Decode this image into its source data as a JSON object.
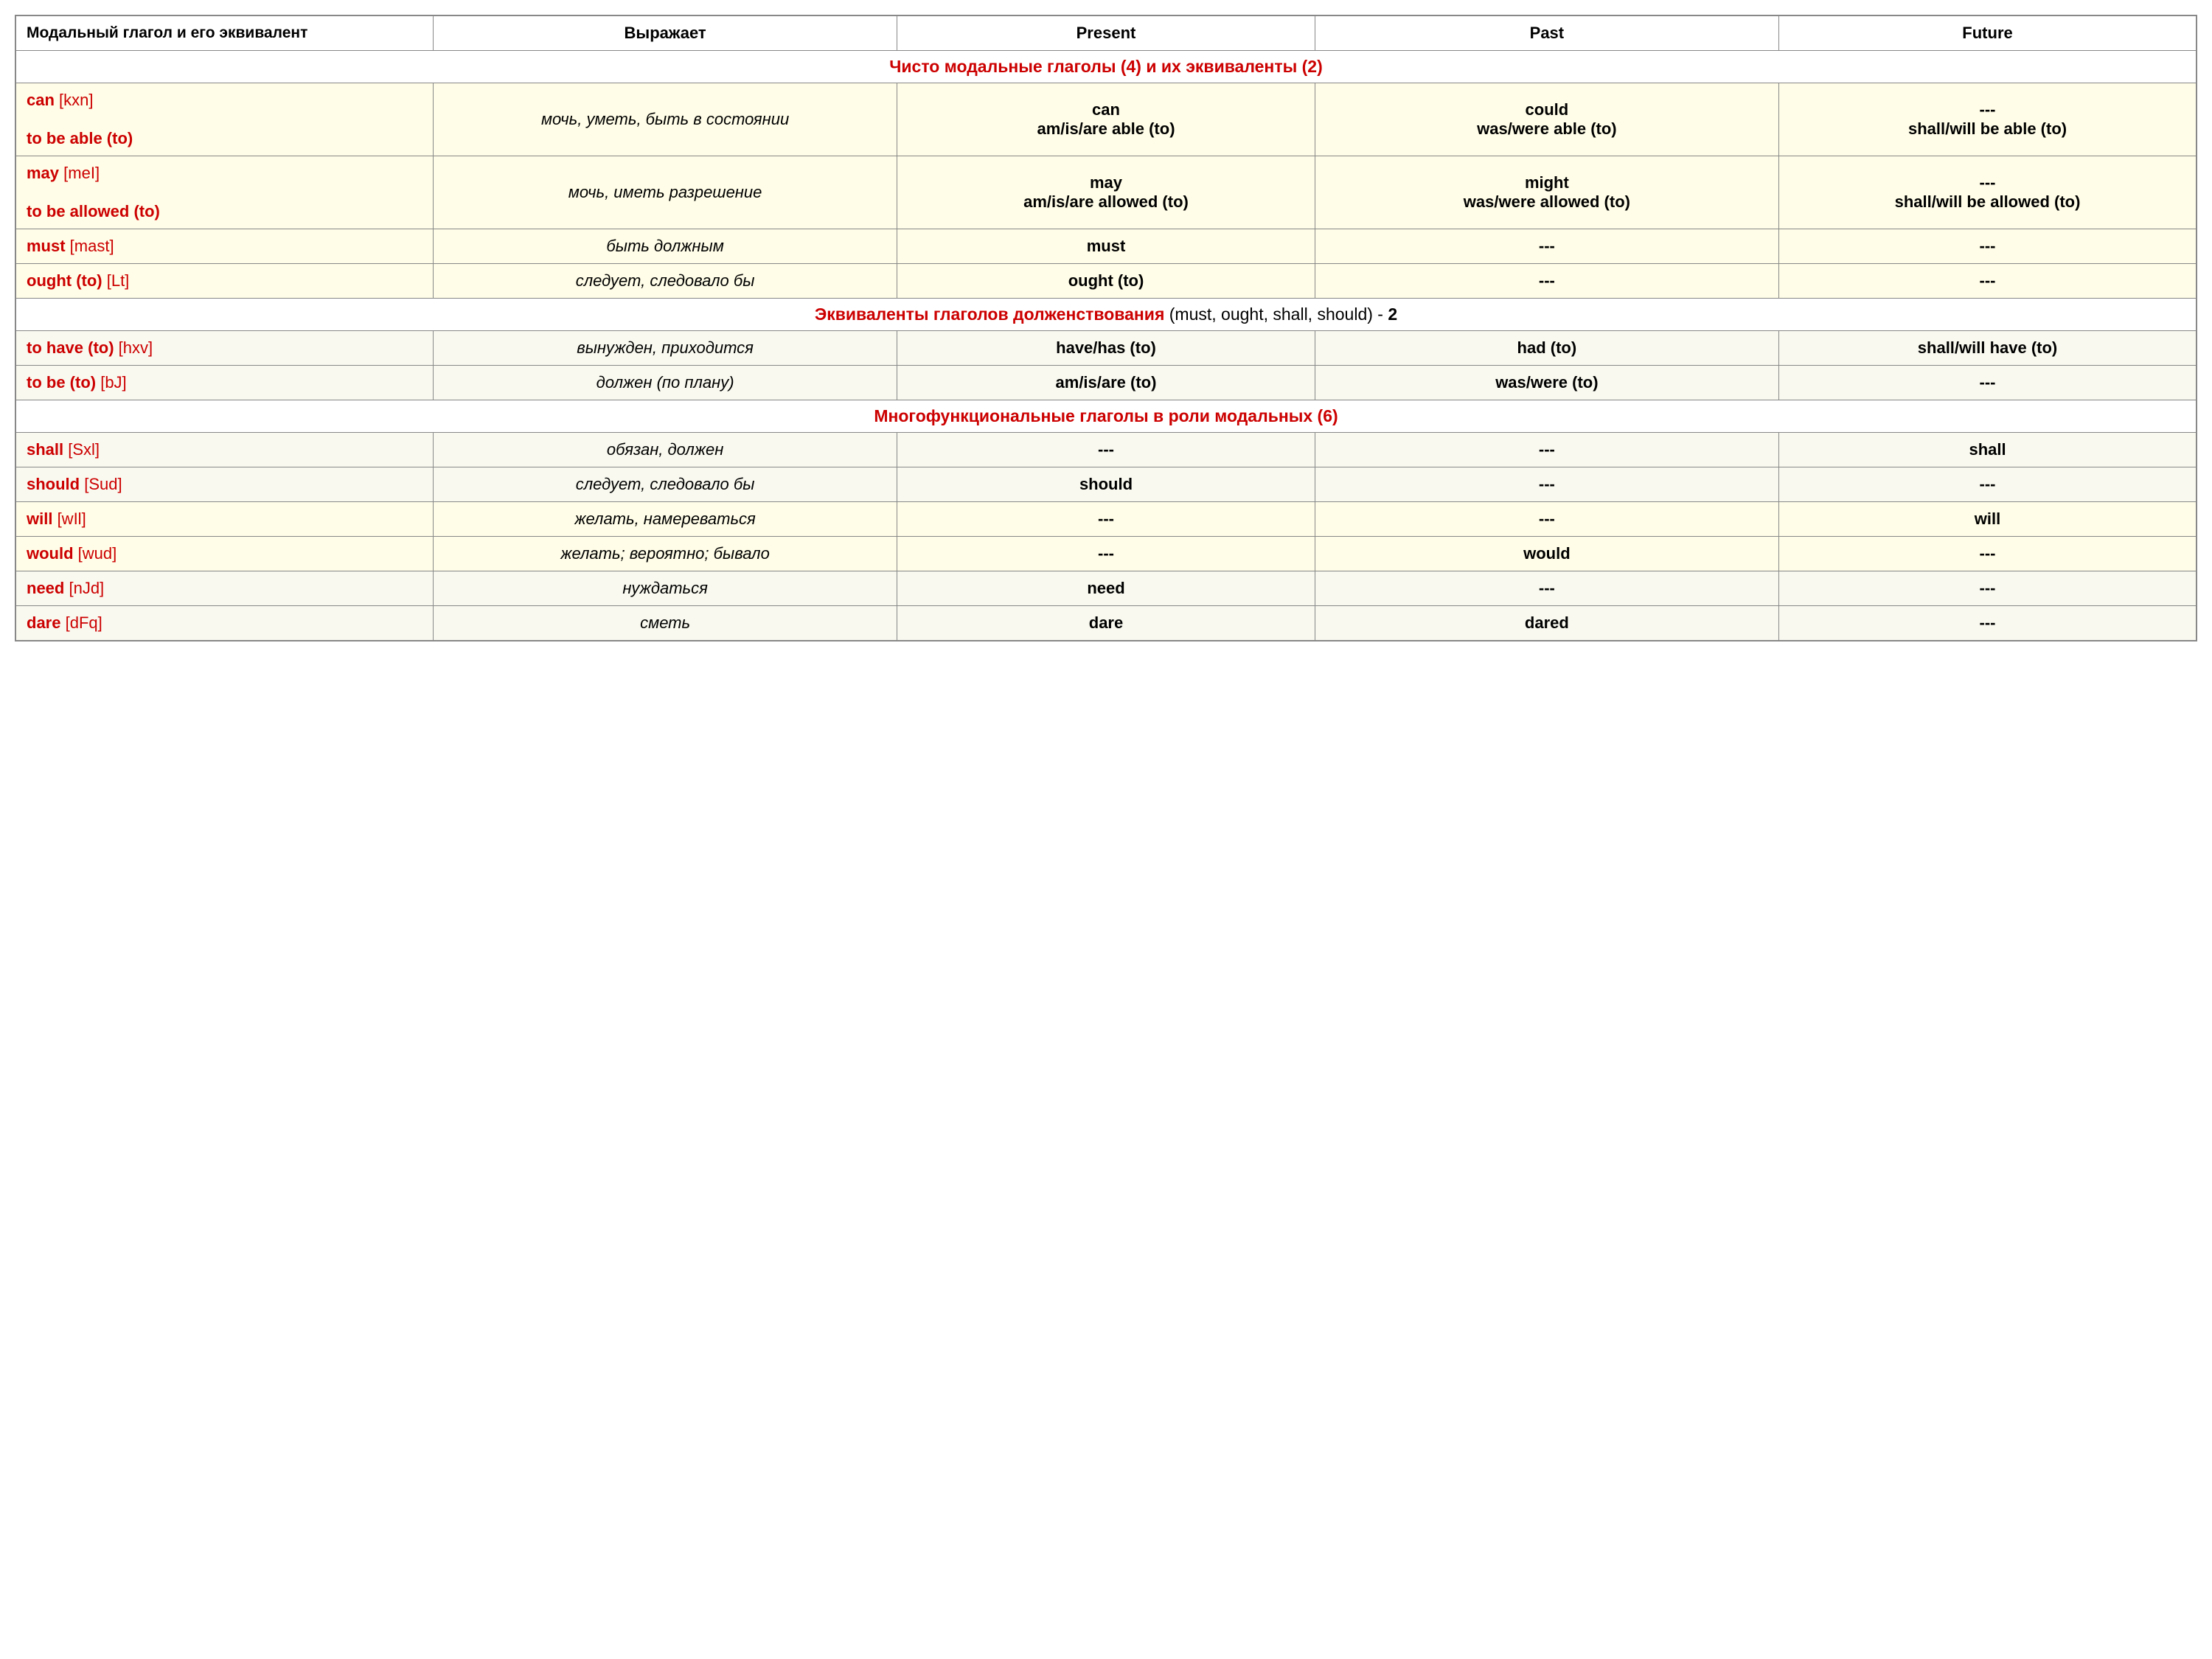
{
  "table": {
    "headers": {
      "col1": "Модальный глагол и его эквивалент",
      "col2": "Выражает",
      "col3": "Present",
      "col4": "Past",
      "col5": "Future"
    },
    "sections": [
      {
        "type": "section-header",
        "text": "Чисто модальные глаголы (4) и их эквиваленты (2)"
      },
      {
        "type": "data-row",
        "bg": "yellow",
        "col1_main": "can",
        "col1_phonetic": "[kxn]",
        "col1_sub": "to be able (to)",
        "col2": "мочь, уметь, быть в состоянии",
        "col3": "can\nam/is/are able (to)",
        "col4": "could\nwas/were able (to)",
        "col5": "---\nshall/will be able (to)"
      },
      {
        "type": "data-row",
        "bg": "yellow",
        "col1_main": "may",
        "col1_phonetic": "[meI]",
        "col1_sub": "to be allowed (to)",
        "col2": "мочь, иметь разрешение",
        "col3": "may\nam/is/are allowed (to)",
        "col4": "might\nwas/were allowed (to)",
        "col5": "---\nshall/will be allowed (to)"
      },
      {
        "type": "data-row",
        "bg": "yellow",
        "col1_main": "must",
        "col1_phonetic": "[mast]",
        "col1_sub": "",
        "col2": "быть должным",
        "col3": "must",
        "col4": "---",
        "col5": "---"
      },
      {
        "type": "data-row",
        "bg": "yellow",
        "col1_main": "ought (to)",
        "col1_phonetic": "[Lt]",
        "col1_sub": "",
        "col2": "следует, следовало бы",
        "col3": "ought (to)",
        "col4": "---",
        "col5": "---"
      },
      {
        "type": "section-header-mixed",
        "red_text": "Эквиваленты глаголов долженствования",
        "black_text": " (must, ought, shall, should) - ",
        "bold_text": "2"
      },
      {
        "type": "data-row",
        "bg": "light",
        "col1_main": "to have (to)",
        "col1_phonetic": "[hxv]",
        "col1_sub": "",
        "col2": "вынужден, приходится",
        "col3": "have/has (to)",
        "col4": "had (to)",
        "col5": "shall/will have (to)"
      },
      {
        "type": "data-row",
        "bg": "light",
        "col1_main": "to be (to)",
        "col1_phonetic": "[bJ]",
        "col1_sub": "",
        "col2": "должен (по плану)",
        "col3": "am/is/are (to)",
        "col4": "was/were (to)",
        "col5": "---"
      },
      {
        "type": "section-header",
        "text": "Многофункциональные глаголы в роли модальных (6)"
      },
      {
        "type": "data-row",
        "bg": "light",
        "col1_main": "shall",
        "col1_phonetic": "[Sxl]",
        "col1_sub": "",
        "col2": "обязан, должен",
        "col3": "---",
        "col4": "---",
        "col5": "shall"
      },
      {
        "type": "data-row",
        "bg": "light",
        "col1_main": "should",
        "col1_phonetic": "[Sud]",
        "col1_sub": "",
        "col2": "следует, следовало бы",
        "col3": "should",
        "col4": "---",
        "col5": "---"
      },
      {
        "type": "data-row",
        "bg": "yellow",
        "col1_main": "will",
        "col1_phonetic": "[wIl]",
        "col1_sub": "",
        "col2": "желать, намереваться",
        "col3": "---",
        "col4": "---",
        "col5": "will"
      },
      {
        "type": "data-row",
        "bg": "yellow",
        "col1_main": "would",
        "col1_phonetic": "[wud]",
        "col1_sub": "",
        "col2": "желать; вероятно; бывало",
        "col3": "---",
        "col4": "would",
        "col5": "---"
      },
      {
        "type": "data-row",
        "bg": "light",
        "col1_main": "need",
        "col1_phonetic": "[nJd]",
        "col1_sub": "",
        "col2": "нуждаться",
        "col3": "need",
        "col4": "---",
        "col5": "---"
      },
      {
        "type": "data-row",
        "bg": "light",
        "col1_main": "dare",
        "col1_phonetic": "[dFq]",
        "col1_sub": "",
        "col2": "сметь",
        "col3": "dare",
        "col4": "dared",
        "col5": "---"
      }
    ]
  }
}
